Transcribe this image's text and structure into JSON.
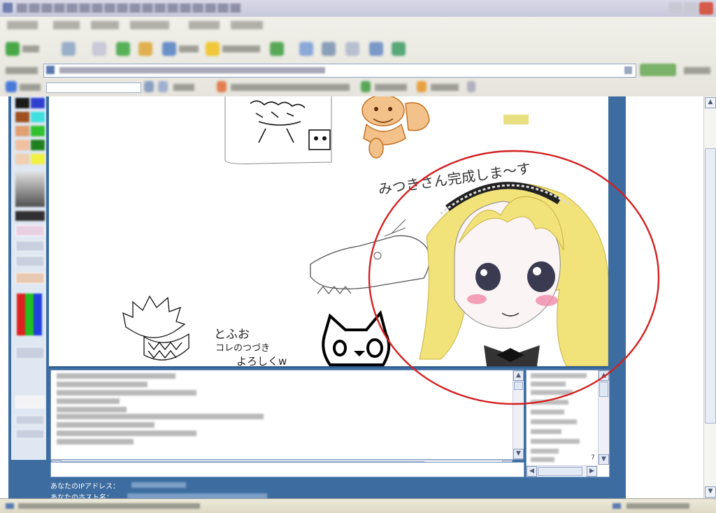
{
  "window": {
    "title": "",
    "menu_items": [
      "",
      "",
      "",
      "",
      "",
      ""
    ]
  },
  "toolbar": {
    "address_value": "",
    "search_value": ""
  },
  "canvas": {
    "doodle_texts": [
      "とふお",
      "コレのつづき",
      "よろしくw",
      "みつきさん完成しま～す"
    ],
    "eye_color": "#3a3a50",
    "hair_color": "#f2e27a",
    "cheek_color": "#f08aa8"
  },
  "palette": {
    "colors": [
      "#1a1a1a",
      "#2f3fd0",
      "#a05020",
      "#40e0e0",
      "#e0a070",
      "#30c030",
      "#f0c0a0",
      "#208020",
      "#f0d0b0",
      "#f0f040"
    ],
    "gradient_colors": [
      "#e02020",
      "#20c020",
      "#2040e0"
    ]
  },
  "chat": {
    "scroll_thumb_glyph": "|||"
  },
  "user_list": {
    "count_glyph": "7"
  },
  "info": {
    "ip_label": "あなたのIPアドレス：",
    "host_label": "あなたのホスト名："
  },
  "annotation": {
    "circle_color": "#d42020"
  },
  "colors": {
    "panel": "#3d6da0",
    "chrome": "#ece9d8"
  }
}
